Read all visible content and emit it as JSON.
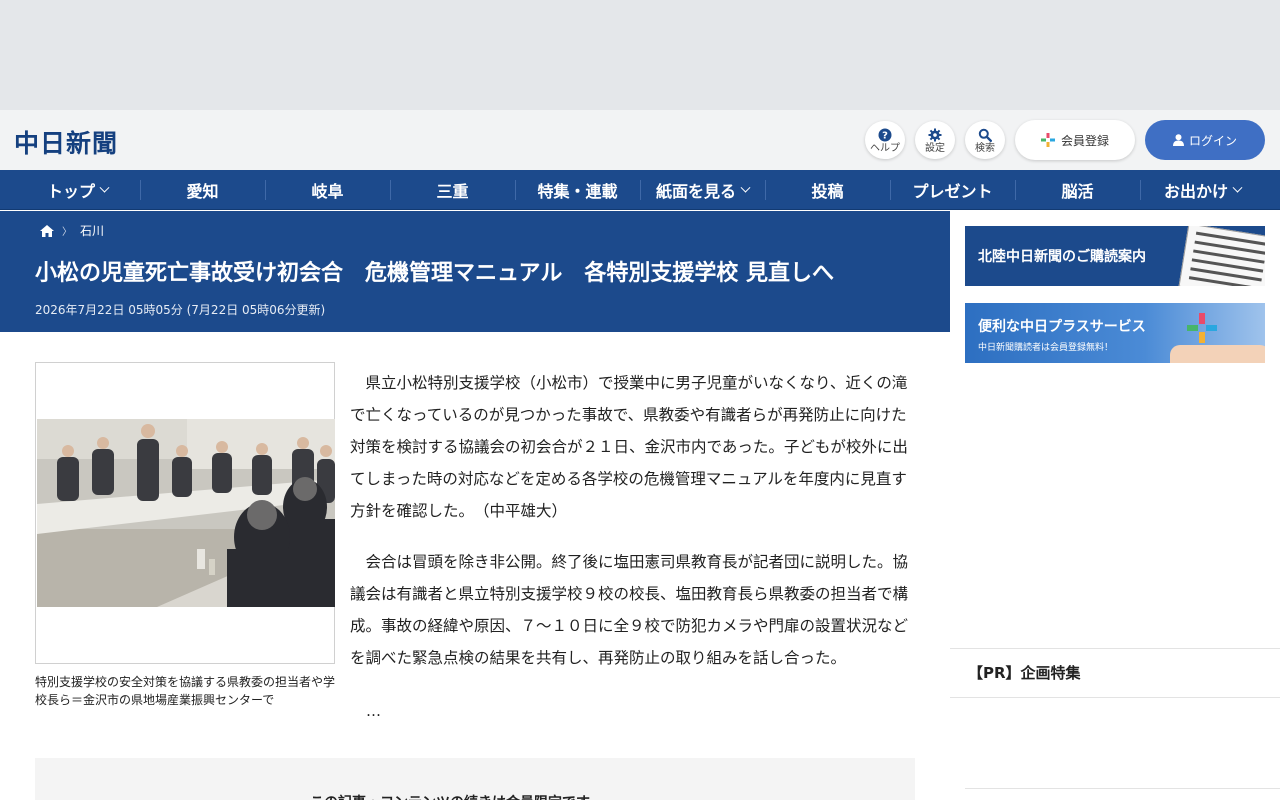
{
  "header": {
    "logo": "中日新聞",
    "help_label": "ヘルプ",
    "settings_label": "設定",
    "search_label": "検索",
    "register_label": "会員登録",
    "login_label": "ログイン"
  },
  "nav": {
    "items": [
      {
        "label": "トップ",
        "dropdown": true
      },
      {
        "label": "愛知",
        "dropdown": false
      },
      {
        "label": "岐阜",
        "dropdown": false
      },
      {
        "label": "三重",
        "dropdown": false
      },
      {
        "label": "特集・連載",
        "dropdown": false
      },
      {
        "label": "紙面を見る",
        "dropdown": true
      },
      {
        "label": "投稿",
        "dropdown": false
      },
      {
        "label": "プレゼント",
        "dropdown": false
      },
      {
        "label": "脳活",
        "dropdown": false
      },
      {
        "label": "お出かけ",
        "dropdown": true
      }
    ]
  },
  "breadcrumb": {
    "current": "石川"
  },
  "article": {
    "title": "小松の児童死亡事故受け初会合　危機管理マニュアル　各特別支援学校 見直しへ",
    "date": "2026年7月22日 05時05分 (7月22日 05時06分更新)",
    "photo_caption": "特別支援学校の安全対策を協議する県教委の担当者や学校長ら＝金沢市の県地場産業振興センターで",
    "paragraphs": [
      "県立小松特別支援学校（小松市）で授業中に男子児童がいなくなり、近くの滝で亡くなっているのが見つかった事故で、県教委や有識者らが再発防止に向けた対策を検討する協議会の初会合が２１日、金沢市内であった。子どもが校外に出てしまった時の対応などを定める各学校の危機管理マニュアルを年度内に見直す方針を確認した。　（中平雄大）",
      "会合は冒頭を除き非公開。終了後に塩田憲司県教育長が記者団に説明した。協議会は有識者と県立特別支援学校９校の校長、塩田教育長ら県教委の担当者で構成。事故の経緯や原因、７～１０日に全９校で防犯カメラや門扉の設置状況などを調べた緊急点検の結果を共有し、再発防止の取り組みを話し合った。"
    ],
    "ellipsis": "…",
    "paywall_text": "この記事・コンテンツの続きは会員限定です。"
  },
  "sidebar": {
    "banner1_text": "北陸中日新聞のご購読案内",
    "banner2_title": "便利な中日プラスサービス",
    "banner2_sub": "中日新聞購読者は会員登録無料！",
    "pr_title": "【PR】企画特集"
  },
  "colors": {
    "brand_navy": "#1c4a8c",
    "login_blue": "#3f6fc4"
  }
}
